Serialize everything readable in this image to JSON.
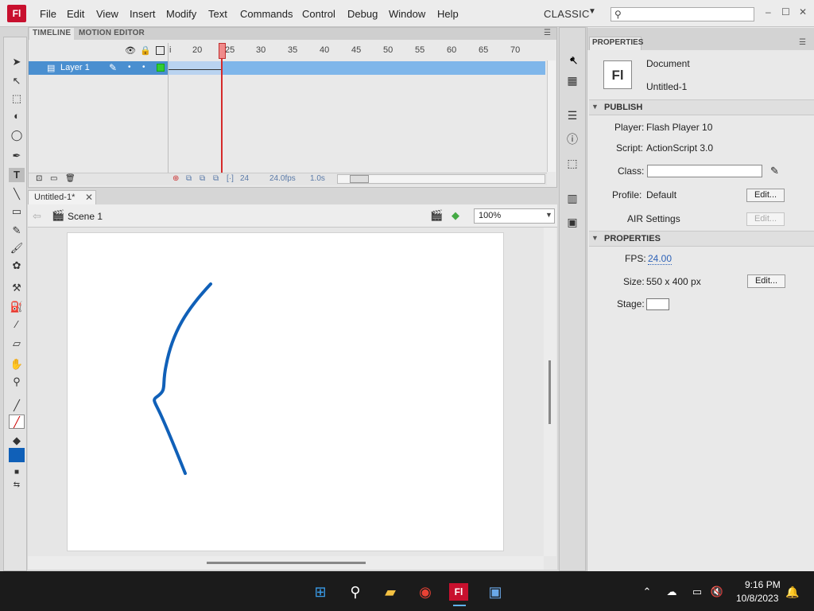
{
  "app": {
    "logo": "Fl",
    "workspace": "CLASSIC",
    "search_placeholder": ""
  },
  "menu": [
    "File",
    "Edit",
    "View",
    "Insert",
    "Modify",
    "Text",
    "Commands",
    "Control",
    "Debug",
    "Window",
    "Help"
  ],
  "window_controls": [
    "–",
    "☐",
    "✕"
  ],
  "timeline": {
    "tabs": [
      "TIMELINE",
      "MOTION EDITOR"
    ],
    "frame_numbers": [
      "i",
      "20",
      "25",
      "30",
      "35",
      "40",
      "45",
      "50",
      "55",
      "60",
      "65",
      "70"
    ],
    "layer": "Layer 1",
    "current_frame": "24",
    "fps": "24.0fps",
    "elapsed": "1.0s"
  },
  "document": {
    "tab": "Untitled-1*",
    "close": "✕",
    "scene": "Scene 1",
    "zoom": "100%"
  },
  "properties": {
    "tab": "PROPERTIES",
    "doc_type": "Document",
    "doc_name": "Untitled-1",
    "publish_header": "PUBLISH",
    "player_label": "Player:",
    "player": "Flash Player 10",
    "script_label": "Script:",
    "script": "ActionScript 3.0",
    "class_label": "Class:",
    "profile_label": "Profile:",
    "profile": "Default",
    "edit": "Edit...",
    "air_label": "AIR Settings",
    "props_header": "PROPERTIES",
    "fps_label": "FPS:",
    "fps": "24.00",
    "size_label": "Size:",
    "size": "550 x 400 px",
    "stage_label": "Stage:",
    "stage_color": "#ffffff"
  },
  "stroke_color": "#1060b8",
  "taskbar": {
    "time": "9:16 PM",
    "date": "10/8/2023"
  }
}
